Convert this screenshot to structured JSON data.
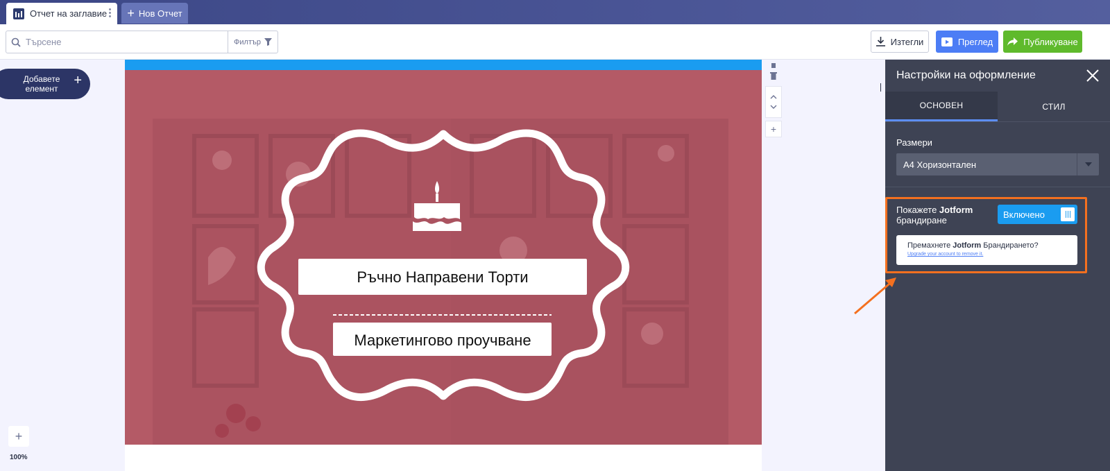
{
  "tabs": {
    "active_title": "Отчет на заглавие",
    "new_label": "Нов Отчет"
  },
  "toolbar": {
    "search_placeholder": "Търсене",
    "filter_label": "Филтър",
    "download_label": "Изтегли",
    "preview_label": "Преглед",
    "publish_label": "Публикуване"
  },
  "left_rail": {
    "add_element_label": "Добавете елемент",
    "zoom_level": "100%"
  },
  "canvas": {
    "title": "Ръчно Направени Торти",
    "subtitle": "Маркетингово проучване"
  },
  "panel": {
    "title": "Настройки на оформление",
    "tabs": [
      "ОСНОВЕН",
      "СТИЛ"
    ],
    "active_tab": 0,
    "size_label": "Размери",
    "size_value": "A4 Хоризонтален",
    "branding_label_pre": "Покажете ",
    "branding_label_brand": "Jotform",
    "branding_label_post": " брандиране",
    "toggle_label": "Включено",
    "remove_pre": "Премахнете ",
    "remove_brand": "Jotform",
    "remove_post": " Брандирането?",
    "upgrade_link": "Upgrade your account to remove it."
  },
  "colors": {
    "tabbar": "#3c4786",
    "preview": "#4c7df5",
    "publish": "#5fba2c",
    "panel": "#3e4354",
    "highlight": "#f4701f",
    "toggle": "#1a9cf0",
    "image_tint": "#b35b67"
  },
  "icons": [
    "report-icon",
    "kebab-icon",
    "plus-icon",
    "search-icon",
    "filter-icon",
    "download-icon",
    "play-icon",
    "share-arrow-icon",
    "close-icon",
    "chevron-down-icon",
    "copy-icon",
    "trash-icon",
    "chevron-up-icon",
    "cake-icon",
    "arrow-icon"
  ]
}
